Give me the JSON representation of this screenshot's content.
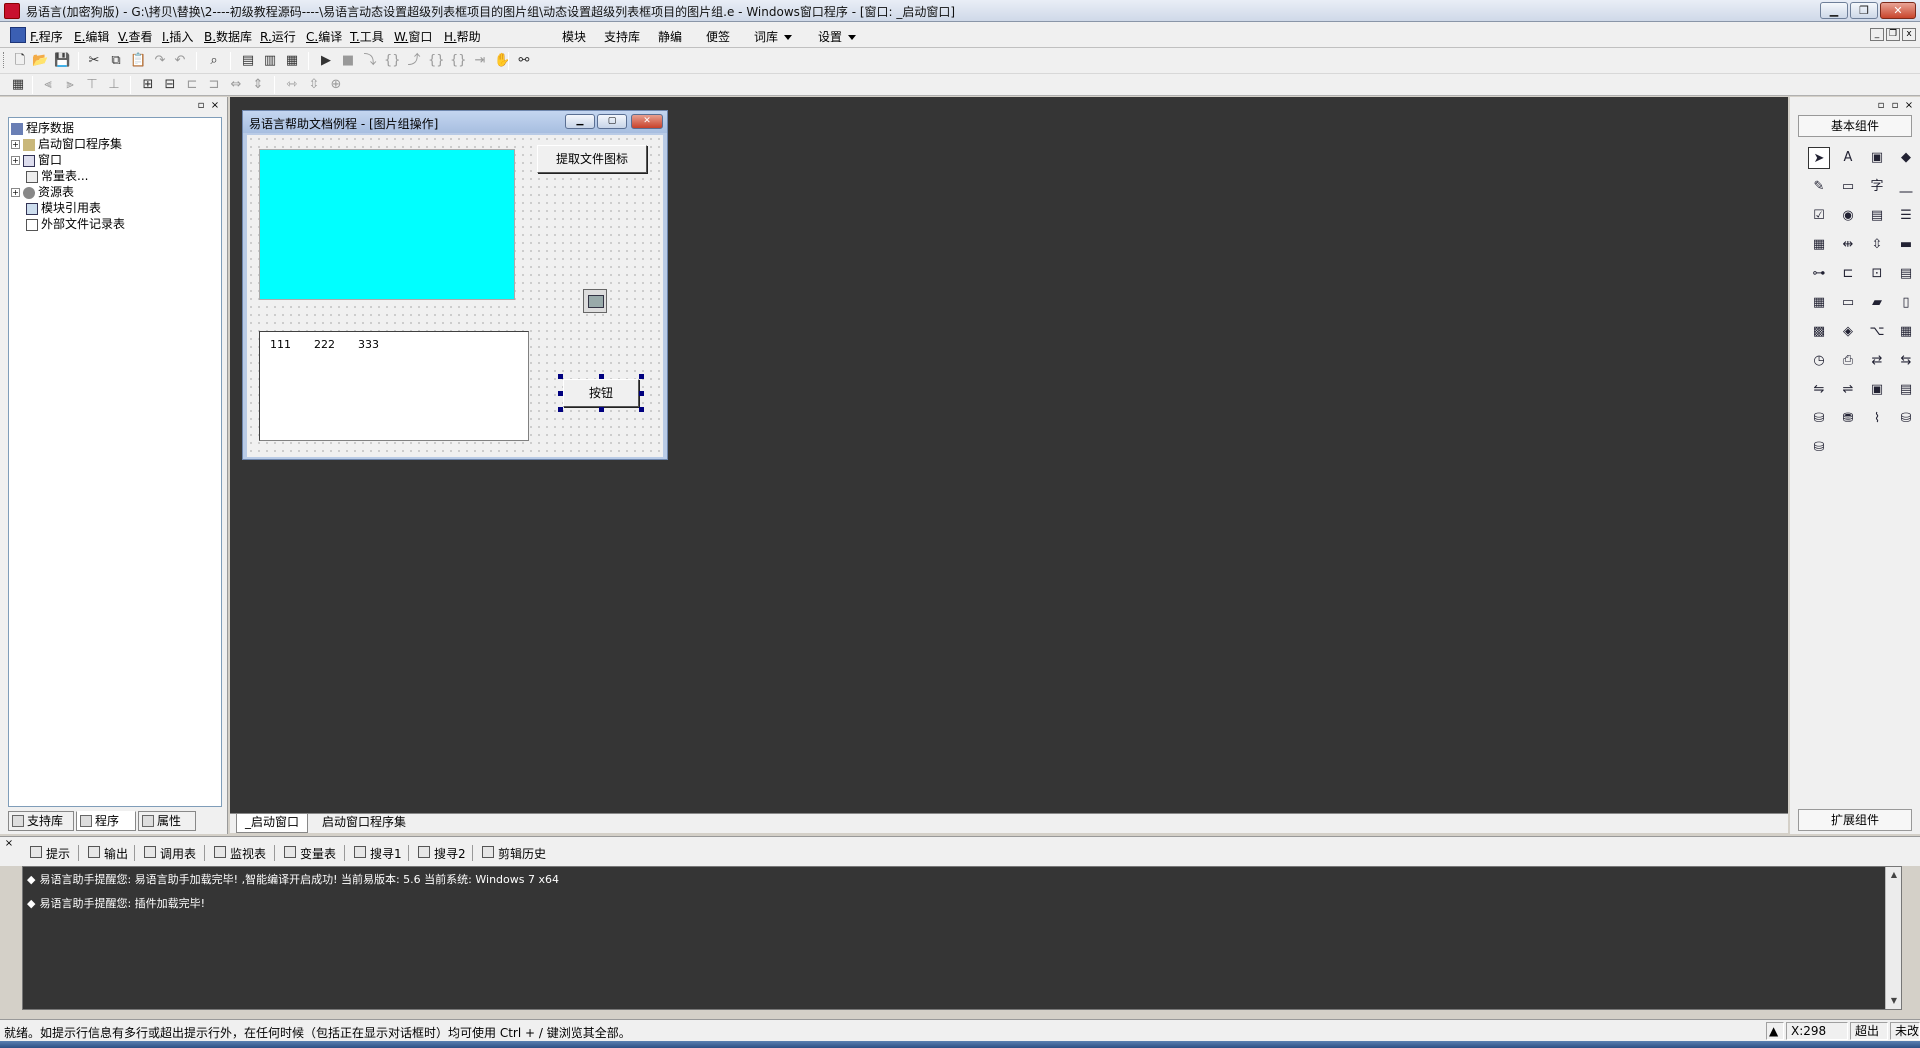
{
  "window": {
    "title": "易语言(加密狗版) - G:\\拷贝\\替换\\2----初级教程源码----\\易语言动态设置超级列表框项目的图片组\\动态设置超级列表框项目的图片组.e - Windows窗口程序 - [窗口: _启动窗口]",
    "min": "▁",
    "max": "❐",
    "close": "✕"
  },
  "menu": {
    "items": [
      {
        "key": "F.",
        "label": "程序"
      },
      {
        "key": "E.",
        "label": "编辑"
      },
      {
        "key": "V.",
        "label": "查看"
      },
      {
        "key": "I.",
        "label": "插入"
      },
      {
        "key": "B.",
        "label": "数据库"
      },
      {
        "key": "R.",
        "label": "运行"
      },
      {
        "key": "C.",
        "label": "编译"
      },
      {
        "key": "T.",
        "label": "工具"
      },
      {
        "key": "W.",
        "label": "窗口"
      },
      {
        "key": "H.",
        "label": "帮助"
      }
    ],
    "extras": [
      "模块",
      "支持库",
      "静编",
      "便签",
      "词库",
      "设置"
    ]
  },
  "left_panel": {
    "tree": [
      {
        "label": "程序数据",
        "level": 0,
        "expander": ""
      },
      {
        "label": "启动窗口程序集",
        "level": 1,
        "expander": "+"
      },
      {
        "label": "窗口",
        "level": 1,
        "expander": "+"
      },
      {
        "label": "常量表...",
        "level": 1,
        "expander": ""
      },
      {
        "label": "资源表",
        "level": 1,
        "expander": "+"
      },
      {
        "label": "模块引用表",
        "level": 1,
        "expander": ""
      },
      {
        "label": "外部文件记录表",
        "level": 1,
        "expander": ""
      }
    ],
    "tabs": [
      "支持库",
      "程序",
      "属性"
    ]
  },
  "designer": {
    "title": "易语言帮助文档例程 - [图片组操作]",
    "button_get_icon": "提取文件图标",
    "button_main": "按钮",
    "list_columns": [
      "111",
      "222",
      "333"
    ],
    "picture_color": "#00ffff"
  },
  "center_tabs": [
    "_启动窗口",
    "启动窗口程序集"
  ],
  "right_panel": {
    "header_basic": "基本组件",
    "header_ext": "扩展组件",
    "component_icons": [
      "pointer-icon",
      "label-icon",
      "picture-icon",
      "shape-icon",
      "edit-icon",
      "frame-icon",
      "text-icon",
      "line-icon",
      "checkbox-icon",
      "radio-icon",
      "combobox-icon",
      "listbox-icon",
      "list-icon",
      "hscroll-icon",
      "vscroll-icon",
      "progress-icon",
      "slider-icon",
      "tab-icon",
      "picturebox-icon",
      "doc-icon",
      "calendar-icon",
      "drive-icon",
      "folder-icon",
      "file-icon",
      "color-icon",
      "network-icon",
      "hotkey-icon",
      "grid-icon",
      "timer-icon",
      "printer-icon",
      "client-icon",
      "server-icon",
      "port-icon",
      "datasource-icon",
      "panel-icon",
      "table-icon",
      "db-icon",
      "dbprovider-icon",
      "chart-icon",
      "odbc-icon",
      "odbc2-icon"
    ]
  },
  "bottom_tabs": [
    "提示",
    "输出",
    "调用表",
    "监视表",
    "变量表",
    "搜寻1",
    "搜寻2",
    "剪辑历史"
  ],
  "output_lines": [
    "易语言助手提醒您: 易语言助手加载完毕! ,智能编译开启成功! 当前易版本: 5.6 当前系统: Windows 7 x64",
    "易语言助手提醒您: 插件加载完毕!"
  ],
  "status": {
    "text": "就绪。如提示行信息有多行或超出提示行外，在任何时候（包括正在显示对话框时）均可使用 Ctrl + / 键浏览其全部。",
    "coord": "X:298",
    "mode": "超出",
    "modified": "未改"
  }
}
